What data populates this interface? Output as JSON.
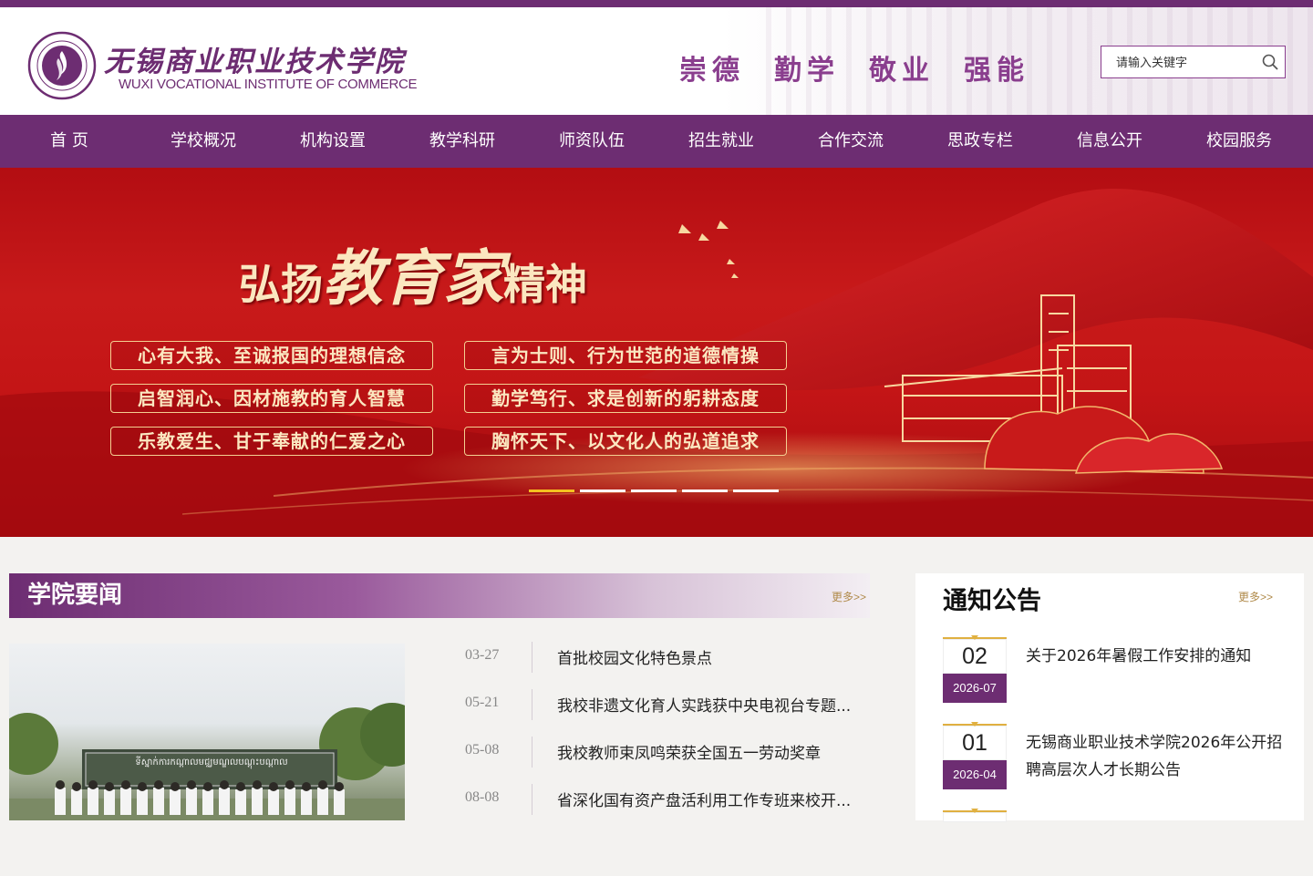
{
  "header": {
    "logo_name_cn": "无锡商业职业技术学院",
    "logo_name_en": "WUXI VOCATIONAL INSTITUTE OF COMMERCE",
    "motto": [
      "崇德",
      "勤学",
      "敬业",
      "强能"
    ],
    "search_placeholder": "请输入关键字"
  },
  "nav": [
    "首 页",
    "学校概况",
    "机构设置",
    "教学科研",
    "师资队伍",
    "招生就业",
    "合作交流",
    "思政专栏",
    "信息公开",
    "校园服务"
  ],
  "banner": {
    "title_lead": "弘扬",
    "title_emph": "教育家",
    "title_tail": "精神",
    "slogans": [
      "心有大我、至诚报国的理想信念",
      "言为士则、行为世范的道德情操",
      "启智润心、因材施教的育人智慧",
      "勤学笃行、求是创新的躬耕态度",
      "乐教爱生、甘于奉献的仁爱之心",
      "胸怀天下、以文化人的弘道追求"
    ],
    "slide_count": 5,
    "active_slide": 1
  },
  "news": {
    "title": "学院要闻",
    "more": "更多>>",
    "photo_sign": "ទីស្នាក់ការកណ្តាលមជ្ឈមណ្ឌលបណ្តុះបណ្តាល",
    "items": [
      {
        "date": "03-27",
        "text": "首批校园文化特色景点"
      },
      {
        "date": "05-21",
        "text": "我校非遗文化育人实践获中央电视台专题..."
      },
      {
        "date": "05-08",
        "text": "我校教师束凤鸣荣获全国五一劳动奖章"
      },
      {
        "date": "08-08",
        "text": "省深化国有资产盘活利用工作专班来校开..."
      }
    ]
  },
  "notices": {
    "title": "通知公告",
    "more": "更多>>",
    "items": [
      {
        "day": "02",
        "ym": "2026-07",
        "text": "关于2026年暑假工作安排的通知"
      },
      {
        "day": "01",
        "ym": "2026-04",
        "text": "无锡商业职业技术学院2026年公开招聘高层次人才长期公告"
      }
    ]
  },
  "colors": {
    "brand": "#6d2d72",
    "banner_red": "#c41516",
    "gold": "#f4cf91",
    "active_dot": "#f4c020"
  }
}
